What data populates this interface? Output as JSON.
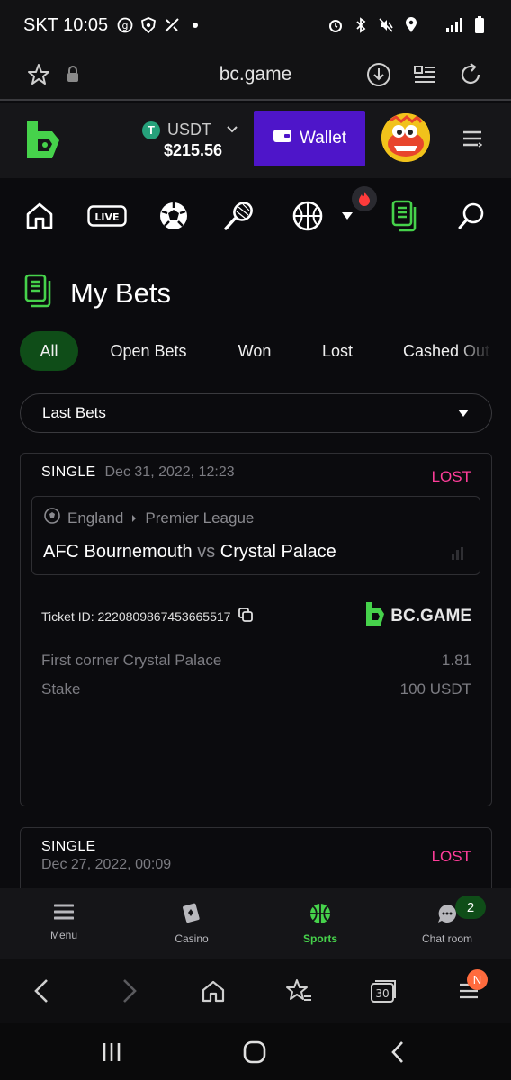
{
  "status_bar": {
    "carrier_time": "SKT 10:05",
    "icons": [
      "g-icon",
      "shield-icon",
      "satellite-icon",
      "dot-icon",
      "alarm-icon",
      "bluetooth-icon",
      "mute-icon",
      "location-icon",
      "lte-signal-icon",
      "battery-icon"
    ],
    "lte_label": "LTE"
  },
  "browser": {
    "url": "bc.game",
    "icons": [
      "star-icon",
      "lock-icon",
      "download-icon",
      "reader-icon",
      "reload-icon"
    ]
  },
  "header": {
    "currency": "USDT",
    "currency_symbol": "T",
    "balance": "$215.56",
    "wallet_label": "Wallet",
    "colors": {
      "wallet_bg": "#4e15c9",
      "logo_green": "#46d24b"
    }
  },
  "nav_icons": [
    "home-icon",
    "live-icon",
    "soccer-icon",
    "tennis-icon",
    "basketball-icon",
    "more-caret-icon",
    "fire-icon",
    "my-bets-icon",
    "search-icon"
  ],
  "live_label": "LIVE",
  "page": {
    "title": "My Bets",
    "tabs": [
      {
        "label": "All",
        "active": true
      },
      {
        "label": "Open Bets",
        "active": false
      },
      {
        "label": "Won",
        "active": false
      },
      {
        "label": "Lost",
        "active": false
      },
      {
        "label": "Cashed Out",
        "active": false
      }
    ],
    "filter_select": "Last Bets"
  },
  "bets": [
    {
      "type": "SINGLE",
      "date": "Dec 31, 2022, 12:23",
      "status": "LOST",
      "country": "England",
      "league": "Premier League",
      "home": "AFC Bournemouth",
      "vs": "vs",
      "away": "Crystal Palace",
      "ticket_label": "Ticket ID: 2220809867453665517",
      "brand": "BC.GAME",
      "selection": "First corner Crystal Palace",
      "odds": "1.81",
      "stake_label": "Stake",
      "stake": "100 USDT"
    },
    {
      "type": "SINGLE",
      "date": "Dec 27, 2022, 00:09",
      "status": "LOST"
    }
  ],
  "bottom_nav": [
    {
      "label": "Menu",
      "icon": "menu-icon",
      "active": false
    },
    {
      "label": "Casino",
      "icon": "casino-icon",
      "active": false
    },
    {
      "label": "Sports",
      "icon": "sports-icon",
      "active": true
    },
    {
      "label": "Chat room",
      "icon": "chat-icon",
      "active": false
    }
  ],
  "chat_badge": "2",
  "browser_tools": {
    "icons": [
      "back-icon",
      "forward-icon",
      "home-icon",
      "bookmarks-icon",
      "tabs-icon",
      "menu-icon"
    ],
    "tab_count": "30",
    "menu_badge": "N"
  },
  "system_nav": [
    "recents-icon",
    "home-button-icon",
    "back-icon"
  ]
}
